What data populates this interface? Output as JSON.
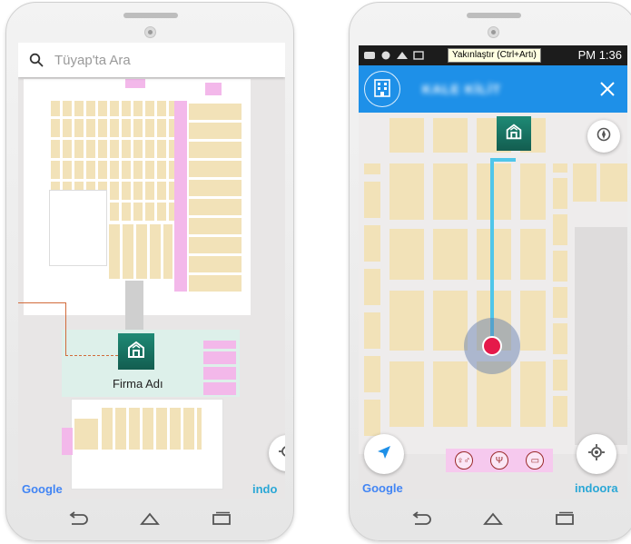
{
  "left_phone": {
    "search": {
      "placeholder": "Tüyap'ta Ara"
    },
    "marker": {
      "label": "Firma Adı"
    },
    "attribution": {
      "google": "Google",
      "indoora": "indo"
    }
  },
  "right_phone": {
    "status": {
      "tooltip": "Yakınlaştır (Ctrl+Artı)",
      "time": "PM 1:36"
    },
    "header": {
      "title": "KALE KİLİT"
    },
    "attribution": {
      "google": "Google",
      "indoora": "indoora"
    }
  },
  "colors": {
    "app_bar": "#1e90e8",
    "route_line": "#4fc6ea",
    "marker_green": "#1a7a68",
    "location_dot": "#e5194a",
    "booth_fill": "#f2e2b8",
    "pink_area": "#f3b8ea"
  },
  "icons": [
    "search-icon",
    "building-icon",
    "close-icon",
    "navigation-arrow-icon",
    "my-location-icon",
    "compass-icon",
    "back-icon",
    "home-icon",
    "recents-icon",
    "restroom-icon",
    "restaurant-icon",
    "info-desk-icon"
  ]
}
